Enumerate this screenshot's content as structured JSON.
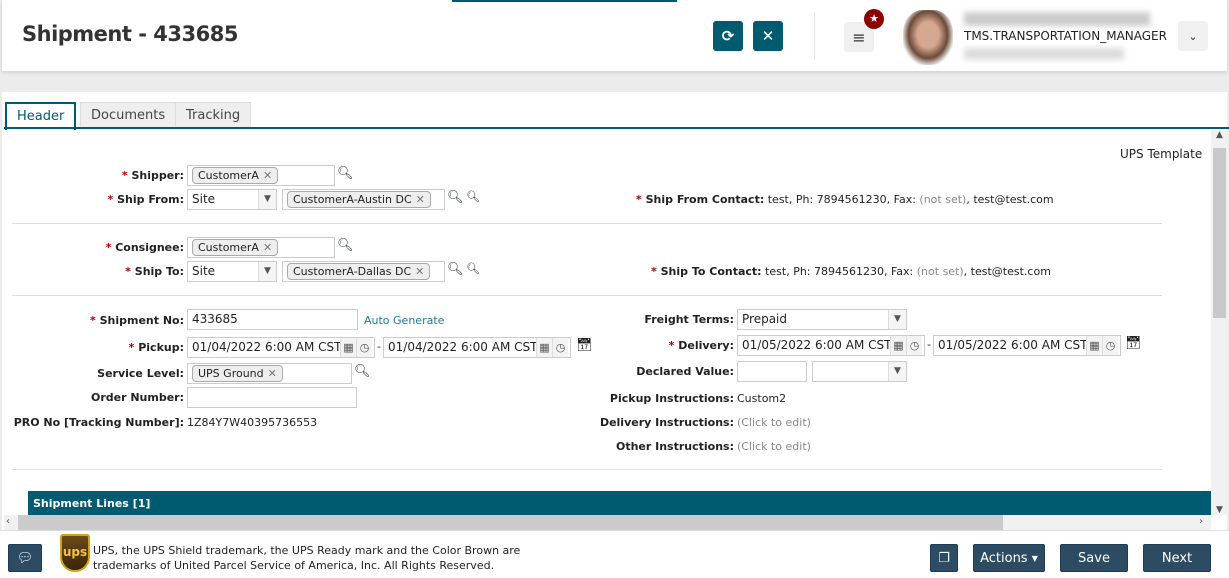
{
  "header": {
    "title": "Shipment - 433685",
    "role": "TMS.TRANSPORTATION_MANAGER",
    "refresh_icon": "refresh-icon",
    "close_icon": "close-icon",
    "menu_icon": "hamburger-icon"
  },
  "tabs": [
    {
      "label": "Header"
    },
    {
      "label": "Documents"
    },
    {
      "label": "Tracking"
    }
  ],
  "form": {
    "template": "UPS Template",
    "shipper": {
      "label": "Shipper:",
      "value": "CustomerA"
    },
    "ship_from": {
      "label": "Ship From:",
      "type": "Site",
      "value": "CustomerA-Austin DC"
    },
    "ship_from_contact": {
      "label": "Ship From Contact:",
      "text1": "test, Ph: 7894561230, Fax:",
      "notset": "(not set)",
      "text2": ", test@test.com"
    },
    "consignee": {
      "label": "Consignee:",
      "value": "CustomerA"
    },
    "ship_to": {
      "label": "Ship To:",
      "type": "Site",
      "value": "CustomerA-Dallas DC"
    },
    "ship_to_contact": {
      "label": "Ship To Contact:",
      "text1": "test, Ph: 7894561230, Fax:",
      "notset": "(not set)",
      "text2": ", test@test.com"
    },
    "shipment_no": {
      "label": "Shipment No:",
      "value": "433685",
      "link": "Auto Generate"
    },
    "pickup": {
      "label": "Pickup:",
      "from": "01/04/2022 6:00 AM CST",
      "to": "01/04/2022 6:00 AM CST"
    },
    "service_level": {
      "label": "Service Level:",
      "value": "UPS Ground"
    },
    "order_number": {
      "label": "Order Number:",
      "value": ""
    },
    "pro_no": {
      "label": "PRO No [Tracking Number]:",
      "value": "1Z84Y7W40395736553"
    },
    "freight_terms": {
      "label": "Freight Terms:",
      "value": "Prepaid"
    },
    "delivery": {
      "label": "Delivery:",
      "from": "01/05/2022 6:00 AM CST",
      "to": "01/05/2022 6:00 AM CST"
    },
    "declared_value": {
      "label": "Declared Value:",
      "value": "",
      "currency": ""
    },
    "pickup_instructions": {
      "label": "Pickup Instructions:",
      "value": "Custom2"
    },
    "delivery_instructions": {
      "label": "Delivery Instructions:",
      "value": "(Click to edit)"
    },
    "other_instructions": {
      "label": "Other Instructions:",
      "value": "(Click to edit)"
    }
  },
  "section": {
    "title": "Shipment Lines [1]"
  },
  "footer": {
    "ups_logo": "ups",
    "disclaimer_1": "UPS, the UPS Shield trademark, the UPS Ready mark and the Color Brown are",
    "disclaimer_2": "trademarks of United Parcel Service of America, Inc. All Rights Reserved.",
    "actions": "Actions",
    "save": "Save",
    "next": "Next"
  },
  "colors": {
    "accent": "#005a70",
    "button": "#2d4b62",
    "required": "#aa0000"
  }
}
